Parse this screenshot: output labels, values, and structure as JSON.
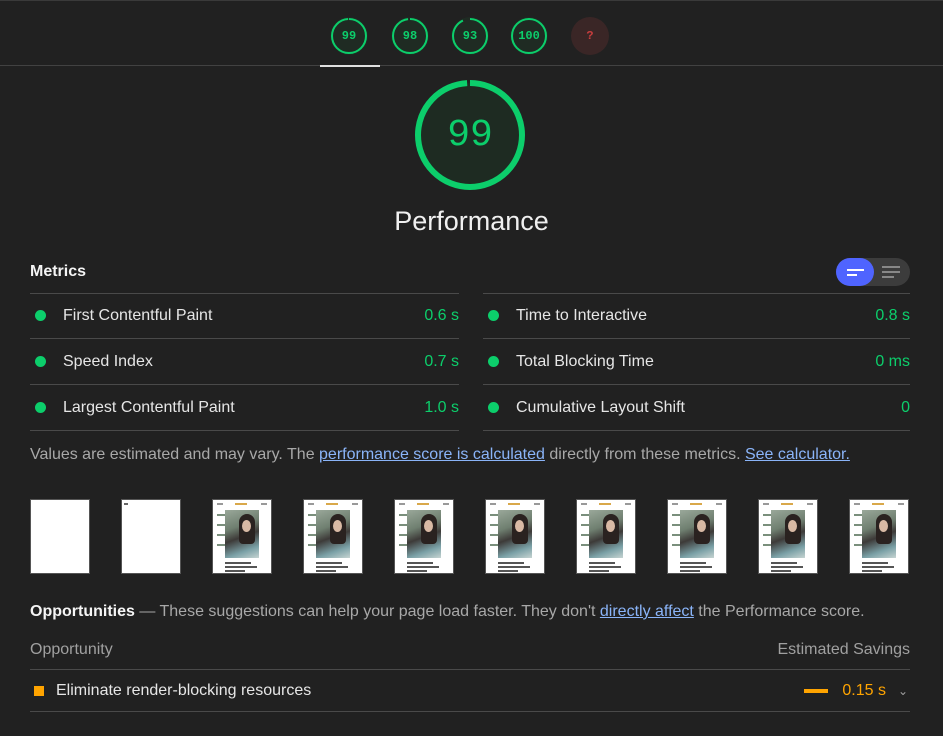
{
  "gauges": [
    {
      "score": "99",
      "value": 99,
      "kind": "pass"
    },
    {
      "score": "98",
      "value": 98,
      "kind": "pass"
    },
    {
      "score": "93",
      "value": 93,
      "kind": "pass"
    },
    {
      "score": "100",
      "value": 100,
      "kind": "pass"
    },
    {
      "score": "?",
      "value": 0,
      "kind": "na"
    }
  ],
  "colors": {
    "pass": "#0cce6b",
    "average": "#ffa400",
    "link": "#8ab4f8",
    "toggle_accent": "#4f64ff"
  },
  "performance": {
    "score": "99",
    "value": 99,
    "title": "Performance"
  },
  "metrics": {
    "heading": "Metrics",
    "items": [
      {
        "label": "First Contentful Paint",
        "value": "0.6 s"
      },
      {
        "label": "Time to Interactive",
        "value": "0.8 s"
      },
      {
        "label": "Speed Index",
        "value": "0.7 s"
      },
      {
        "label": "Total Blocking Time",
        "value": "0 ms"
      },
      {
        "label": "Largest Contentful Paint",
        "value": "1.0 s"
      },
      {
        "label": "Cumulative Layout Shift",
        "value": "0"
      }
    ]
  },
  "note": {
    "prefix": "Values are estimated and may vary. The ",
    "link1": "performance score is calculated",
    "middle": " directly from these metrics. ",
    "link2": "See calculator."
  },
  "filmstrip_frames": 10,
  "opportunities": {
    "title": "Opportunities",
    "dash": " — ",
    "desc_prefix": "These suggestions can help your page load faster. They don't ",
    "link": "directly affect",
    "desc_suffix": " the Performance score.",
    "col_opportunity": "Opportunity",
    "col_savings": "Estimated Savings",
    "items": [
      {
        "label": "Eliminate render-blocking resources",
        "savings": "0.15 s"
      }
    ]
  }
}
